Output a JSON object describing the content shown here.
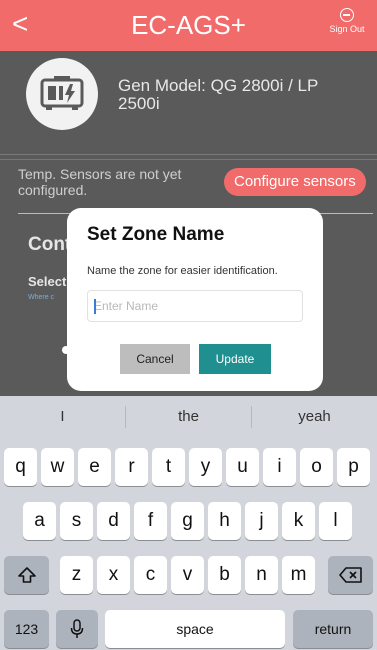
{
  "header": {
    "back_glyph": "<",
    "title": "EC-AGS+",
    "sign_out_label": "Sign Out"
  },
  "generator": {
    "icon": "generator-icon",
    "model_text": "Gen Model: QG 2800i / LP 2500i"
  },
  "sensors": {
    "status_text": "Temp. Sensors are not yet configured.",
    "configure_label": "Configure sensors"
  },
  "section": {
    "title": "Cont",
    "select_text": "Select",
    "where_text": "Where c"
  },
  "dialog": {
    "title": "Set Zone Name",
    "message": "Name the zone for easier identification.",
    "input_placeholder": "Enter Name",
    "input_value": "",
    "cancel_label": "Cancel",
    "update_label": "Update"
  },
  "keyboard": {
    "suggestions": [
      "I",
      "the",
      "yeah"
    ],
    "row1": [
      "q",
      "w",
      "e",
      "r",
      "t",
      "y",
      "u",
      "i",
      "o",
      "p"
    ],
    "row2": [
      "a",
      "s",
      "d",
      "f",
      "g",
      "h",
      "j",
      "k",
      "l"
    ],
    "row3": [
      "z",
      "x",
      "c",
      "v",
      "b",
      "n",
      "m"
    ],
    "numbers_label": "123",
    "space_label": "space",
    "return_label": "return",
    "icons": {
      "shift": "shift-icon",
      "delete": "backspace-icon",
      "mic": "microphone-icon"
    }
  },
  "colors": {
    "header": "#f26b6b",
    "configure_button": "#f26b6b",
    "update_button": "#1f8f8f",
    "cancel_button": "#bdbdbd"
  }
}
